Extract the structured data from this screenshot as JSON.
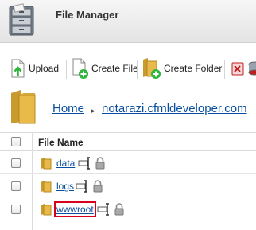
{
  "app": {
    "title": "File Manager"
  },
  "toolbar": {
    "upload_label": "Upload",
    "create_file_label": "Create File",
    "create_folder_label": "Create Folder"
  },
  "breadcrumb": {
    "home": "Home",
    "separator": "▸",
    "current": "notarazi.cfmldeveloper.com"
  },
  "table": {
    "header": {
      "name": "File Name"
    },
    "rows": [
      {
        "name": "data"
      },
      {
        "name": "logs"
      },
      {
        "name": "wwwroot",
        "highlighted": true
      }
    ]
  },
  "colors": {
    "link": "#0a4f9e",
    "highlight": "#d9001b",
    "folder": "#e9b949",
    "add_badge": "#2fb53b"
  }
}
